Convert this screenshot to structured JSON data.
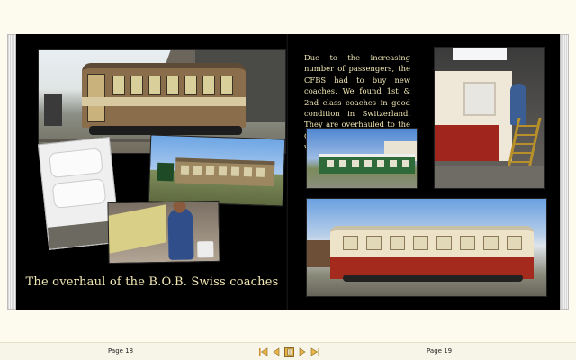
{
  "book": {
    "left_caption": "The overhaul of the B.O.B. Swiss coaches",
    "right_text": "Due to the increasing number of passengers, the CFBS had to buy new coaches. We found 1st & 2nd class coaches in good condition in Switzerland. They are overhauled to the CFBS standard by volunteers."
  },
  "photos": [
    {
      "id": "coach-at-shed",
      "label": ""
    },
    {
      "id": "white-coach-side",
      "label": ""
    },
    {
      "id": "station-train",
      "label": ""
    },
    {
      "id": "man-painting",
      "label": ""
    },
    {
      "id": "worker-on-ladder",
      "label": ""
    },
    {
      "id": "green-train",
      "label": ""
    },
    {
      "id": "red-cream-coach",
      "label": ""
    }
  ],
  "toolbar": {
    "left_page": "Page 18",
    "right_page": "Page 19",
    "nav_icons": [
      "first-page-icon",
      "prev-page-icon",
      "current-page-icon",
      "next-page-icon",
      "last-page-icon"
    ],
    "accent": "#e9b44a"
  },
  "colors": {
    "background": "#fdfbee",
    "page": "#000000",
    "text": "#f2e8b4"
  }
}
